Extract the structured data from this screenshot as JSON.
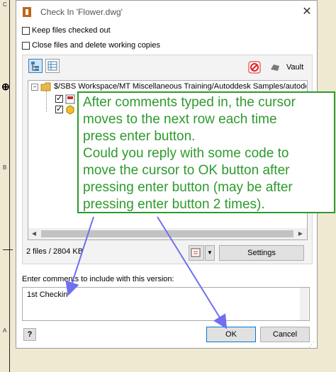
{
  "background": {
    "ruler_labels": [
      "C",
      "B",
      "A"
    ]
  },
  "dialog": {
    "title": "Check In 'Flower.dwg'",
    "close_glyph": "✕",
    "options": [
      {
        "label": "Keep files checked out",
        "checked": false
      },
      {
        "label": "Close files and delete working copies",
        "checked": false
      }
    ],
    "toolbar": {
      "vault_label": "Vault"
    },
    "tree": {
      "root_path": "$/SBS Workspace/MT Miscellaneous Training/Autoddesk Samples/autodesk_in"
    },
    "status": {
      "files_info": "2 files / 2804 KB"
    },
    "settings_label": "Settings",
    "comments": {
      "prompt": "Enter comments to include with this version:",
      "value": "1st Checkin"
    },
    "ok_label": "OK",
    "cancel_label": "Cancel",
    "help_glyph": "?"
  },
  "annotation": {
    "lines": [
      "After comments typed in, the cursor",
      "moves to the next row each time",
      "press enter button.",
      "Could you reply with some code to",
      "move the cursor to OK button after",
      "pressing enter button (may be after",
      "pressing enter button 2 times)."
    ]
  },
  "colors": {
    "callout_green": "#2d9a2d",
    "arrow_blue": "#6f6ff0",
    "accent_blue": "#0078d7"
  }
}
